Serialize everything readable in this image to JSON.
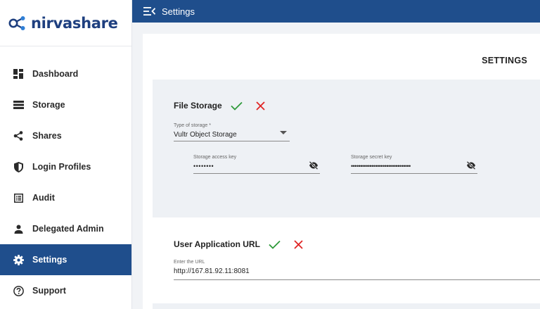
{
  "brand": {
    "name_part1": "nirva",
    "name_part2": "share",
    "color": "#1e3f7f"
  },
  "sidebar": {
    "items": [
      {
        "label": "Dashboard",
        "icon": "dashboard-icon",
        "active": false
      },
      {
        "label": "Storage",
        "icon": "storage-icon",
        "active": false
      },
      {
        "label": "Shares",
        "icon": "share-icon",
        "active": false
      },
      {
        "label": "Login Profiles",
        "icon": "shield-icon",
        "active": false
      },
      {
        "label": "Audit",
        "icon": "audit-list-icon",
        "active": false
      },
      {
        "label": "Delegated Admin",
        "icon": "person-icon",
        "active": false
      },
      {
        "label": "Settings",
        "icon": "gear-icon",
        "active": true
      },
      {
        "label": "Support",
        "icon": "help-circle-icon",
        "active": false
      }
    ]
  },
  "topbar": {
    "title": "Settings",
    "menu_icon": "menu-collapse-icon",
    "color": "#1f4e8c"
  },
  "page": {
    "heading": "SETTINGS"
  },
  "file_storage": {
    "title": "File Storage",
    "type_label": "Type of storage *",
    "type_value": "Vultr Object Storage",
    "access_key_label": "Storage access key",
    "access_key_value": "••••••••",
    "secret_key_label": "Storage secret key",
    "secret_key_value": "••••••••••••••••••••••••••••••••"
  },
  "user_app_url": {
    "title": "User Application URL",
    "url_label": "Enter the URL",
    "url_value": "http://167.81.92.11:8081"
  },
  "colors": {
    "confirm": "#2e9a3a",
    "cancel": "#e02424",
    "panel": "#eef1f5"
  }
}
